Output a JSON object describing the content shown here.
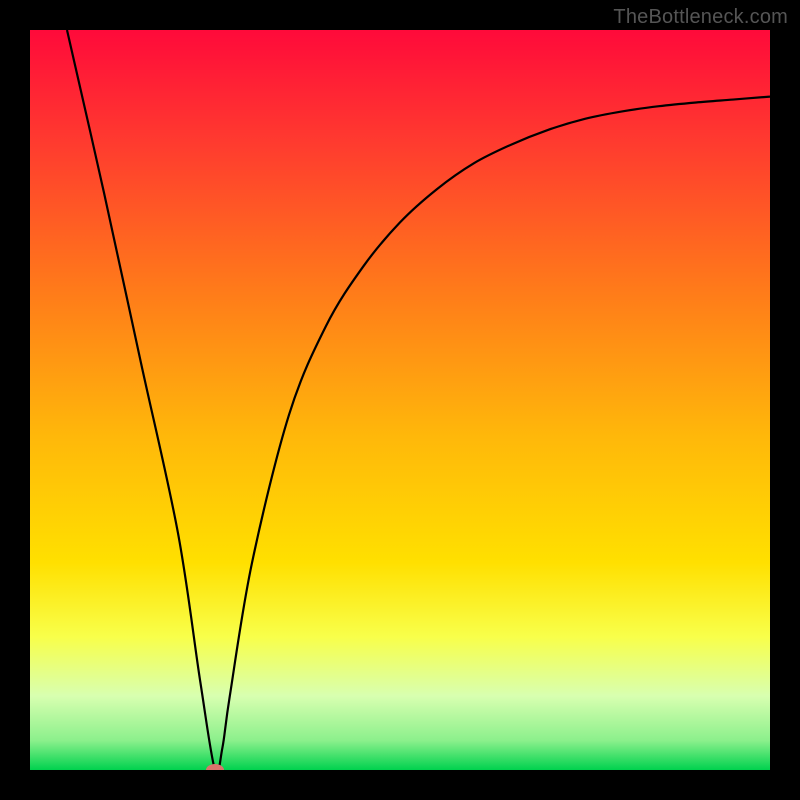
{
  "watermark": "TheBottleneck.com",
  "chart_data": {
    "type": "line",
    "title": "",
    "xlabel": "",
    "ylabel": "",
    "xlim": [
      0,
      100
    ],
    "ylim": [
      0,
      100
    ],
    "gradient_stops": [
      {
        "offset": 0.0,
        "color": "#ff0a3a"
      },
      {
        "offset": 0.15,
        "color": "#ff3a2f"
      },
      {
        "offset": 0.35,
        "color": "#ff7a1a"
      },
      {
        "offset": 0.55,
        "color": "#ffb80a"
      },
      {
        "offset": 0.72,
        "color": "#ffe000"
      },
      {
        "offset": 0.82,
        "color": "#f8ff4a"
      },
      {
        "offset": 0.9,
        "color": "#d8ffb0"
      },
      {
        "offset": 0.96,
        "color": "#8cf08c"
      },
      {
        "offset": 1.0,
        "color": "#00d24e"
      }
    ],
    "series": [
      {
        "name": "bottleneck-curve",
        "x": [
          5,
          10,
          15,
          20,
          23,
          25,
          26,
          27,
          30,
          35,
          40,
          45,
          50,
          55,
          60,
          65,
          70,
          75,
          80,
          85,
          90,
          95,
          100
        ],
        "y": [
          100,
          78,
          55,
          32,
          12,
          0,
          3,
          10,
          28,
          48,
          60,
          68,
          74,
          78.5,
          82,
          84.5,
          86.5,
          88,
          89,
          89.7,
          90.2,
          90.6,
          91
        ]
      }
    ],
    "marker": {
      "x": 25,
      "y": 0,
      "color": "#d9746c",
      "rx": 9,
      "ry": 6
    }
  }
}
